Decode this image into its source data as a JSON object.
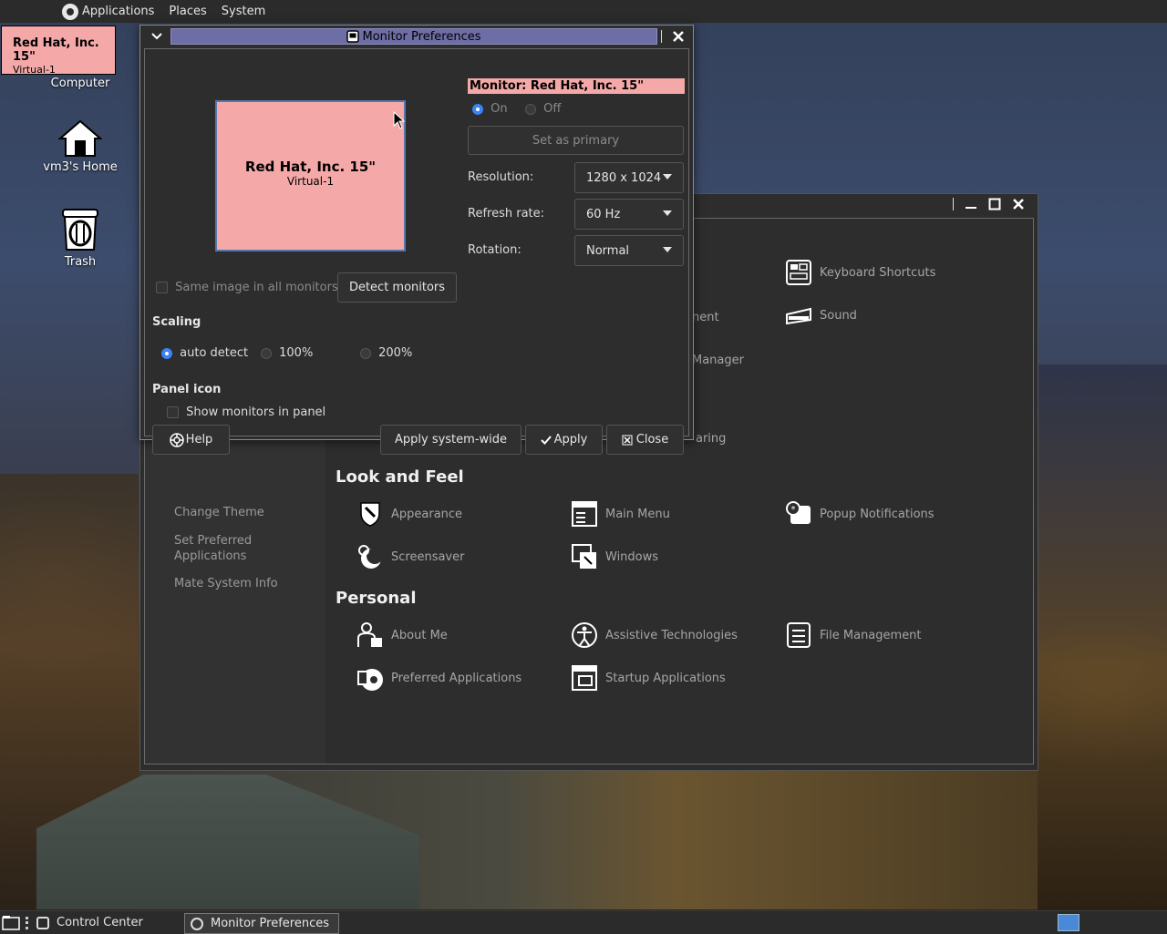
{
  "top_panel": {
    "menus": [
      "Applications",
      "Places",
      "System"
    ]
  },
  "desktop": {
    "monitor_label": {
      "name": "Red Hat, Inc. 15\"",
      "sub": "Virtual-1"
    },
    "icons": [
      "Computer",
      "vm3's Home",
      "Trash"
    ]
  },
  "control_center": {
    "sidebar": [
      "Change Theme",
      "Set Preferred\nApplications",
      "Mate System Info"
    ],
    "partial_items": [
      "nent",
      "Manager",
      "aring"
    ],
    "sections": {
      "hardware_items": [
        "Keyboard Shortcuts",
        "Sound"
      ],
      "look_and_feel": {
        "title": "Look and Feel",
        "items": [
          "Appearance",
          "Main Menu",
          "Popup Notifications",
          "Screensaver",
          "Windows"
        ]
      },
      "personal": {
        "title": "Personal",
        "items": [
          "About Me",
          "Assistive Technologies",
          "File Management",
          "Preferred Applications",
          "Startup Applications"
        ]
      }
    }
  },
  "monitor_prefs": {
    "title": "Monitor Preferences",
    "preview": {
      "name": "Red Hat, Inc. 15\"",
      "sub": "Virtual-1"
    },
    "monitor_heading": "Monitor: Red Hat, Inc. 15\"",
    "power": {
      "on": "On",
      "off": "Off",
      "selected": "On"
    },
    "set_primary": "Set as primary",
    "resolution": {
      "label": "Resolution:",
      "value": "1280 x 1024"
    },
    "refresh": {
      "label": "Refresh rate:",
      "value": "60 Hz"
    },
    "rotation": {
      "label": "Rotation:",
      "value": "Normal"
    },
    "same_image": "Same image in all monitors",
    "detect": "Detect monitors",
    "scaling": {
      "title": "Scaling",
      "options": [
        "auto detect",
        "100%",
        "200%"
      ],
      "selected": "auto detect"
    },
    "panel_icon": {
      "title": "Panel icon",
      "show": "Show monitors in panel"
    },
    "buttons": {
      "help": "Help",
      "apply_system": "Apply system-wide",
      "apply": "Apply",
      "close": "Close"
    }
  },
  "taskbar": {
    "tasks": [
      "Control Center",
      "Monitor Preferences"
    ]
  },
  "colors": {
    "accent": "#3b82f6",
    "monitor_pink": "#f4a9a8",
    "titlebar": "#6e6ea6"
  }
}
